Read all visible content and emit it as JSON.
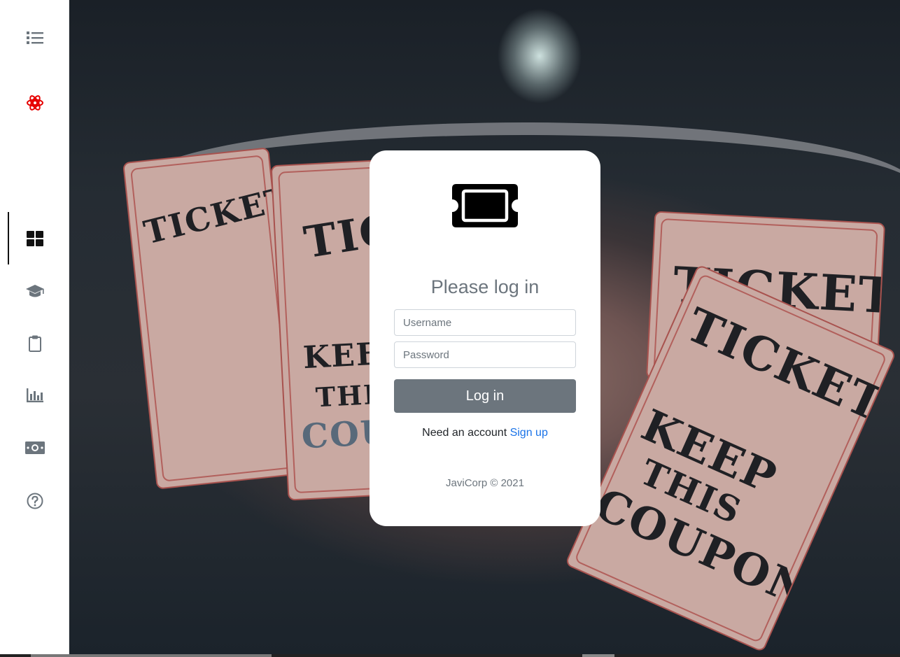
{
  "sidebar": {
    "items": [
      {
        "icon": "list-icon",
        "color": "#6c757d"
      },
      {
        "icon": "react-atom-icon",
        "color": "#e60000"
      },
      {
        "icon": "dashboard-grid-icon",
        "color": "#111111",
        "active": true
      },
      {
        "icon": "graduation-cap-icon",
        "color": "#6c757d"
      },
      {
        "icon": "clipboard-icon",
        "color": "#6c757d"
      },
      {
        "icon": "bar-chart-icon",
        "color": "#6c757d"
      },
      {
        "icon": "money-bill-icon",
        "color": "#6c757d"
      },
      {
        "icon": "question-circle-icon",
        "color": "#6c757d"
      }
    ]
  },
  "login": {
    "logo_icon": "ticket-icon",
    "title": "Please log in",
    "username_placeholder": "Username",
    "password_placeholder": "Password",
    "submit_label": "Log in",
    "signup_prompt": "Need an account",
    "signup_link": "Sign up",
    "copyright": "JaviCorp © 2021"
  },
  "background": {
    "ticket_words": [
      "TICKET",
      "TICKET",
      "TICKET",
      "TICKET",
      "KEEP",
      "THIS",
      "COUPON",
      "KEEP",
      "THIS",
      "COUPON"
    ]
  },
  "colors": {
    "button": "#6c757d",
    "link": "#1a73e8",
    "accent_react": "#e60000"
  }
}
